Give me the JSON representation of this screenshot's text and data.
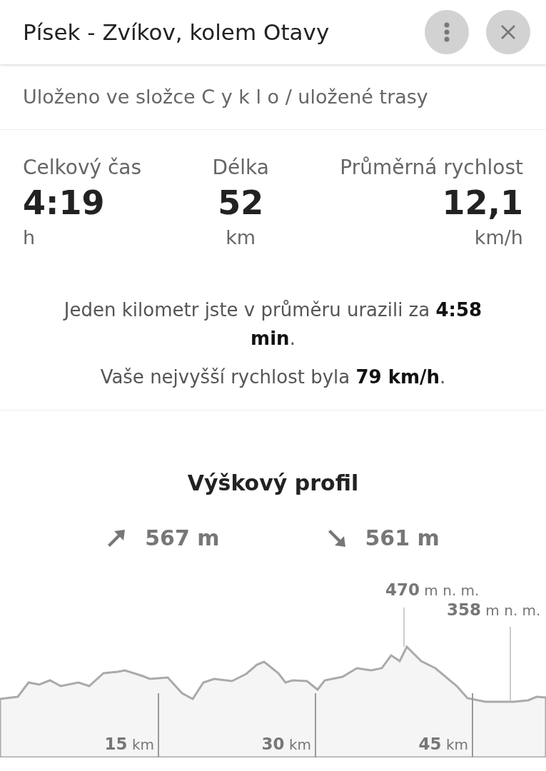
{
  "header": {
    "title": "Písek - Zvíkov, kolem Otavy"
  },
  "folder": "Uloženo ve složce C y k l o / uložené trasy",
  "stats": [
    {
      "label": "Celkový čas",
      "value": "4:19",
      "unit": "h"
    },
    {
      "label": "Délka",
      "value": "52",
      "unit": "km"
    },
    {
      "label": "Průměrná rychlost",
      "value": "12,1",
      "unit": "km/h"
    }
  ],
  "notes": [
    "Jeden kilometr jste v průměru urazili za **4:58 min**.",
    "Vaše nejvyšší rychlost byla **79 km/h**."
  ],
  "profile": {
    "title": "Výškový profil",
    "ascent": "567 m",
    "descent": "561 m",
    "markers": [
      "**470** m n. m.",
      "**358** m n. m."
    ],
    "distances": [
      "**15** km",
      "**30** km",
      "**45** km"
    ]
  }
}
